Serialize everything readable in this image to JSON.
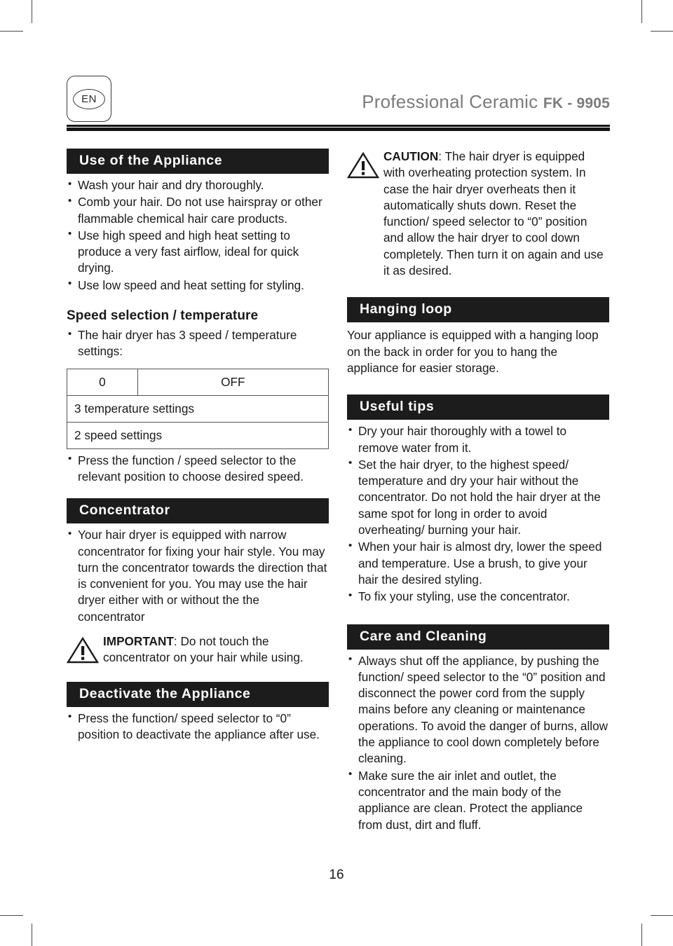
{
  "header": {
    "language_badge": "EN",
    "brand_primary": "Professional",
    "brand_secondary": "Ceramic",
    "brand_model": "FK - 9905"
  },
  "left_column": {
    "use_section": {
      "title": "Use of the Appliance",
      "bullets": [
        "Wash your hair and dry thoroughly.",
        "Comb your hair. Do not use hairspray or other flammable chemical hair care products.",
        "Use high speed and high heat setting to produce a very fast airflow, ideal for quick drying.",
        "Use low speed and heat setting for styling."
      ]
    },
    "speed_section": {
      "subheading": "Speed selection / temperature",
      "intro_bullet": "The hair dryer has 3 speed / temperature settings:",
      "table": {
        "row1_left": "0",
        "row1_right": "OFF",
        "row2": "3 temperature settings",
        "row3": "2 speed settings"
      },
      "outro_bullet": "Press the function / speed selector to the relevant position to choose desired speed."
    },
    "concentrator_section": {
      "title": "Concentrator",
      "bullets": [
        "Your hair dryer is equipped with narrow concentrator for fixing your hair style. You may turn the concentrator towards the direction that is convenient for you. You may use the hair dryer either with or without the the concentrator"
      ],
      "important_label": "IMPORTANT",
      "important_text": ": Do not touch the concentrator on your hair while using."
    },
    "deactivate_section": {
      "title": "Deactivate the Appliance",
      "bullets": [
        "Press the function/ speed selector to “0” position to deactivate the appliance after use."
      ]
    }
  },
  "right_column": {
    "caution_block": {
      "label": "CAUTION",
      "text": ": The hair dryer is equipped with overheating protection system. In case the hair dryer overheats then it automatically shuts down. Reset the function/ speed selector to “0” position and allow the hair dryer to cool down completely. Then turn it on again and use it as desired."
    },
    "hanging_loop_section": {
      "title": "Hanging loop",
      "paragraph": "Your appliance is equipped with a hanging loop on the back in order for you to hang the appliance for easier storage."
    },
    "useful_tips_section": {
      "title": "Useful tips",
      "bullets": [
        "Dry your hair thoroughly with a towel to remove water from it.",
        "Set the hair dryer, to the highest speed/ temperature and dry your hair without the concentrator. Do not hold the hair dryer at the same spot for long in order to avoid overheating/ burning your hair.",
        "When your hair is almost dry, lower the speed and temperature. Use a brush, to give your hair the desired styling.",
        "To fix your styling, use the concentrator."
      ]
    },
    "care_section": {
      "title": "Care and Cleaning",
      "bullets": [
        "Always shut off the appliance, by pushing the function/ speed selector to the “0” position and disconnect the power cord from the supply mains before any cleaning or maintenance operations. To avoid the danger of burns, allow the appliance to cool down completely before cleaning.",
        "Make sure the air inlet and outlet, the concentrator and the main body of the appliance are clean. Protect the appliance from dust, dirt and fluff."
      ]
    }
  },
  "footer": {
    "page_number": "16"
  },
  "colors": {
    "banner_background": "#1c1c1c",
    "banner_text": "#ffffff",
    "body_text": "#1a1a1a",
    "brand_text": "#7c7c7c",
    "table_border": "#555555"
  }
}
